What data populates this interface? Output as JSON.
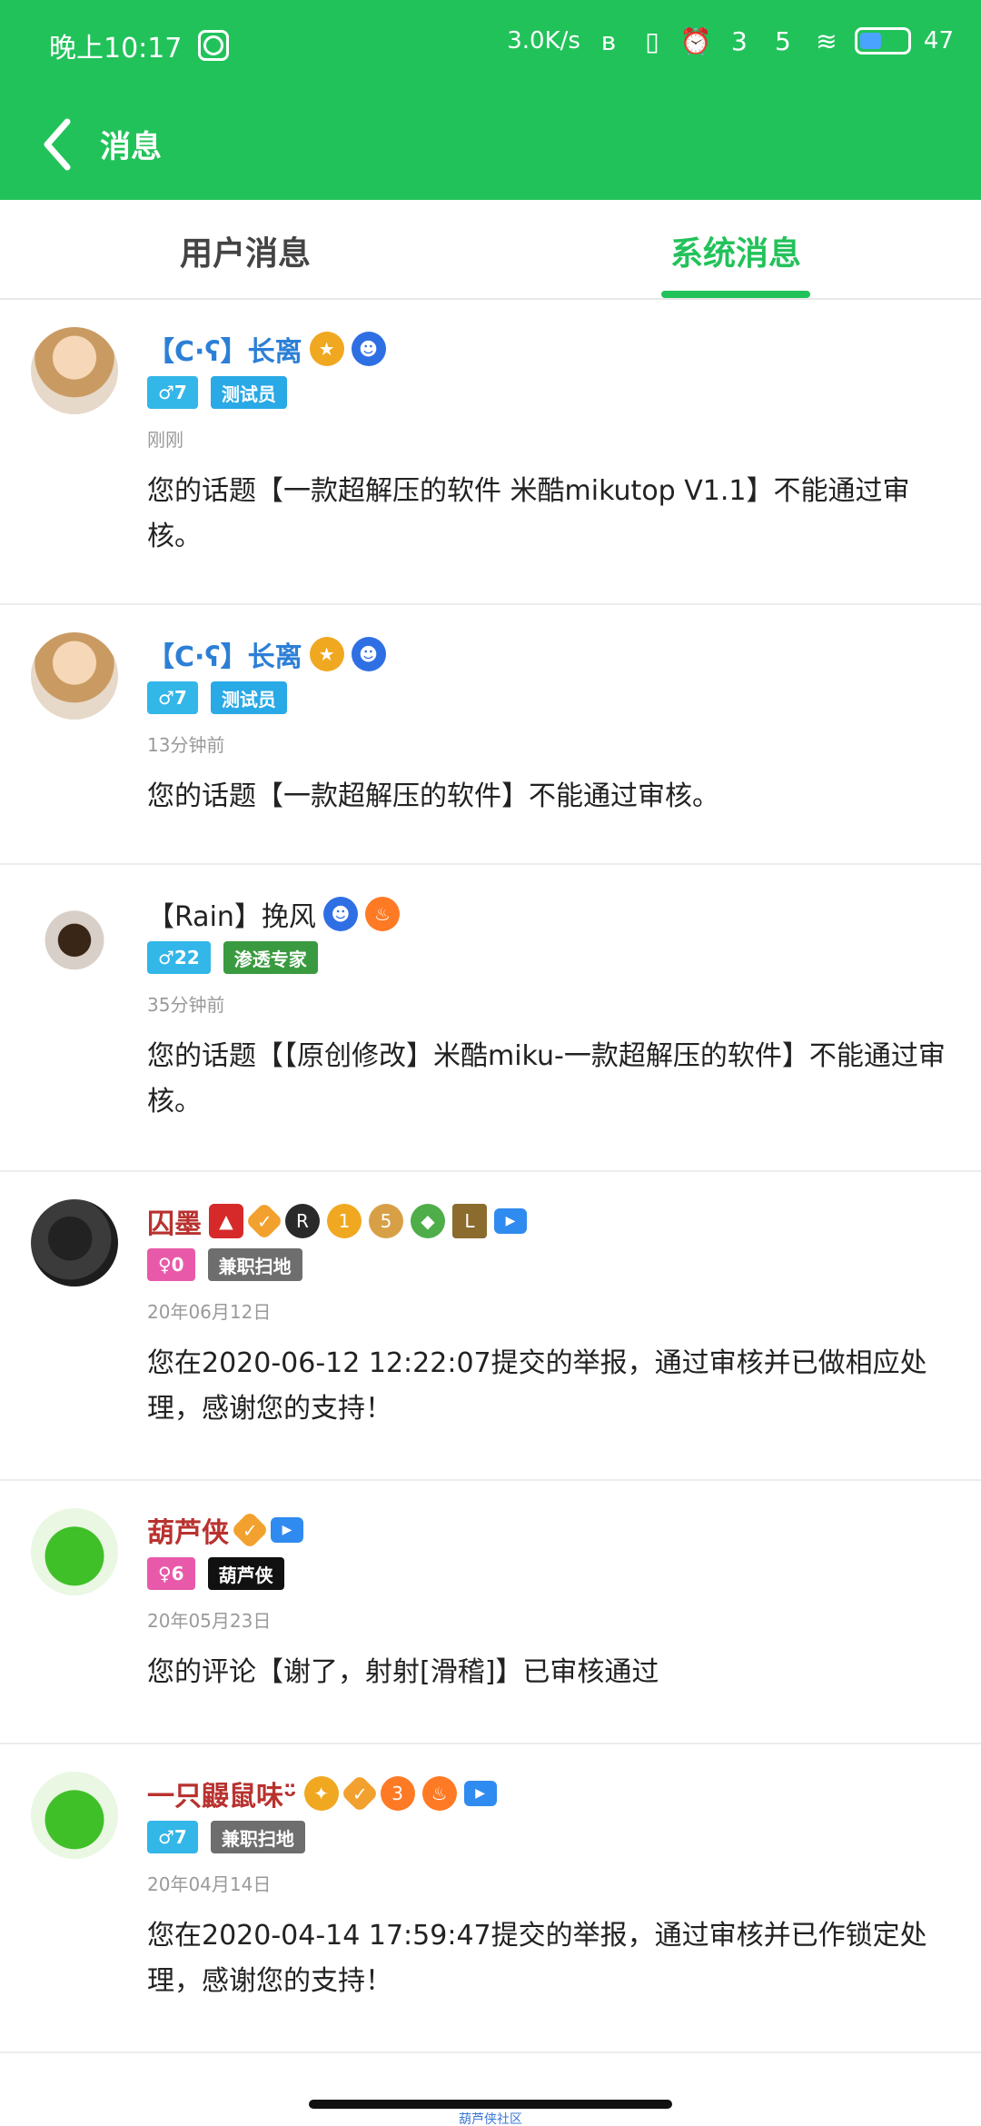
{
  "status_bar": {
    "time": "晚上10:17",
    "net_speed": "3.0K/s",
    "alarm_count_1": "3",
    "alarm_count_2": "5",
    "battery": "47"
  },
  "app_bar": {
    "title": "消息"
  },
  "tabs": [
    {
      "label": "用户消息",
      "active": false
    },
    {
      "label": "系统消息",
      "active": true
    }
  ],
  "messages": [
    {
      "name": "【C·ʕ】长离",
      "name_color": "#2c7fd6",
      "gender": "♂7",
      "role": "测试员",
      "time": "刚刚",
      "text": "您的话题【一款超解压的软件 米酷mikutop V1.1】不能通过审核。"
    },
    {
      "name": "【C·ʕ】长离",
      "name_color": "#2c7fd6",
      "gender": "♂7",
      "role": "测试员",
      "time": "13分钟前",
      "text": "您的话题【一款超解压的软件】不能通过审核。"
    },
    {
      "name": "【Rain】挽风",
      "name_color": "#222222",
      "gender": "♂22",
      "role": "渗透专家",
      "time": "35分钟前",
      "text": "您的话题【【原创修改】米酷miku-一款超解压的软件】不能通过审核。"
    },
    {
      "name": "囚墨",
      "name_color": "#b8322f",
      "gender": "♀0",
      "role": "兼职扫地",
      "time": "20年06月12日",
      "text": "您在2020-06-12 12:22:07提交的举报，通过审核并已做相应处理，感谢您的支持！"
    },
    {
      "name": "葫芦侠",
      "name_color": "#b8322f",
      "gender": "♀6",
      "role": "葫芦侠",
      "time": "20年05月23日",
      "text": "您的评论【谢了，射射[滑稽]】已审核通过"
    },
    {
      "name": "一只鼹鼠味ᵕ̈",
      "name_color": "#b8322f",
      "gender": "♂7",
      "role": "兼职扫地",
      "time": "20年04月14日",
      "text": "您在2020-04-14 17:59:47提交的举报，通过审核并已作锁定处理，感谢您的支持！"
    }
  ],
  "icons": [
    "back-arrow-icon",
    "wifi-icon",
    "alarm-icon",
    "battery-icon",
    "video-icon",
    "verified-icon"
  ],
  "colors": {
    "accent": "#22c25a",
    "male_tag": "#33b6e8",
    "female_tag": "#e85aa9"
  },
  "footer": {
    "caption": "葫芦侠社区"
  }
}
